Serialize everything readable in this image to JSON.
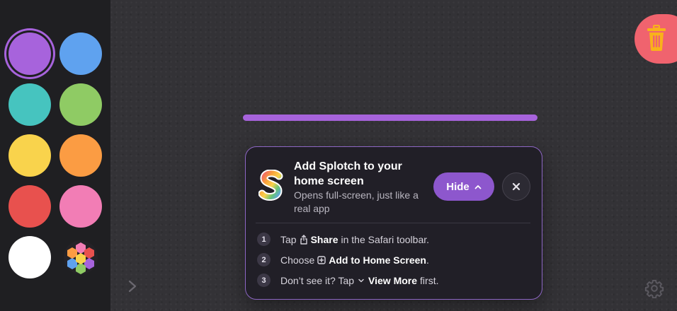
{
  "palette": {
    "colors": [
      "#a763dc",
      "#5fa2ef",
      "#46c4bf",
      "#8fcb64",
      "#f9d34c",
      "#fb9c43",
      "#e8514e",
      "#f27db5",
      "#ffffff"
    ],
    "selected_color": "#a763dc",
    "custom_icon": "color-wheel-icon"
  },
  "toolbar": {
    "expand_icon": "chevron-right-icon",
    "trash_icon": "trash-icon",
    "settings_icon": "gear-icon"
  },
  "install_card": {
    "app_icon": "splotch-logo",
    "title": "Add Splotch to your home screen",
    "subtitle": "Opens full-screen, just like a real app",
    "hide_label": "Hide",
    "close_label": "✕",
    "steps": [
      {
        "number": "1",
        "pre": "Tap",
        "icon": "share-icon",
        "bold": "Share",
        "post": "in the Safari toolbar."
      },
      {
        "number": "2",
        "pre": "Choose",
        "icon": "add-square-icon",
        "bold": "Add to Home Screen",
        "post": "."
      },
      {
        "number": "3",
        "pre": "Don’t see it? Tap",
        "icon": "chevron-down-icon",
        "bold": "View More",
        "post": "first."
      }
    ]
  }
}
